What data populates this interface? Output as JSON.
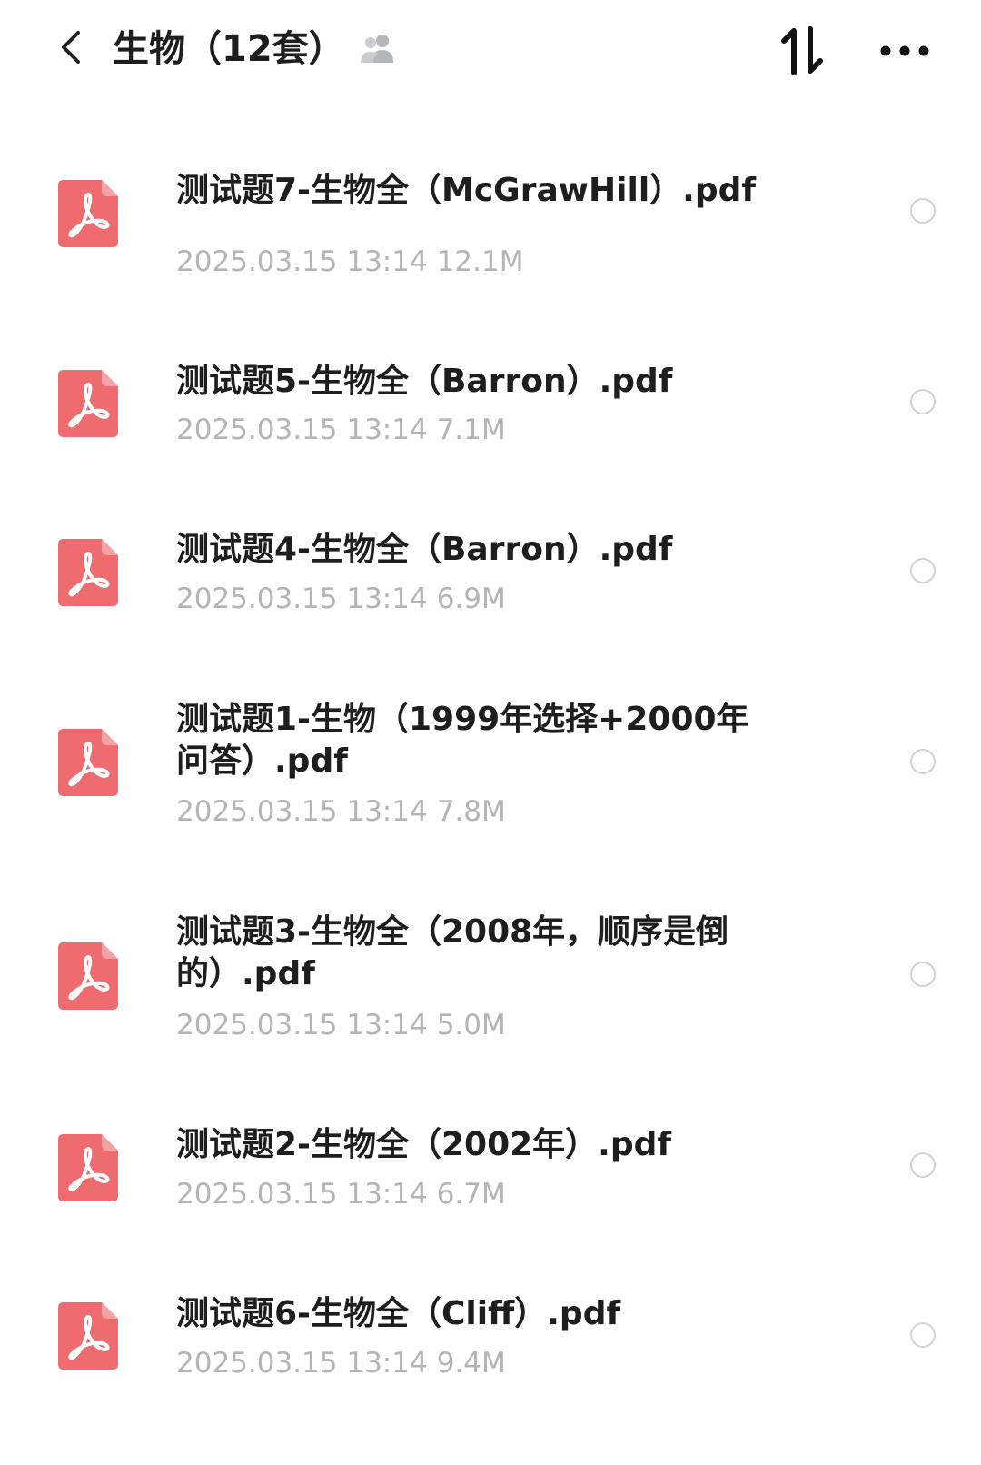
{
  "header": {
    "title": "生物（12套）",
    "back_icon": "chevron-left-icon",
    "group_icon": "people-icon",
    "sort_icon": "sort-arrows-icon",
    "more_icon": "more-horizontal-icon"
  },
  "colors": {
    "pdf_icon": "#ee6b6f",
    "meta_text": "#b4b4b4",
    "title_text": "#1e1e1e",
    "select_circle": "#d2d2d2"
  },
  "files": [
    {
      "name_lines": [
        "测试题7-生物全（McGrawHill）.pdf"
      ],
      "date": "2025.03.15 13:14",
      "size": "12.1M"
    },
    {
      "name_lines": [
        "测试题5-生物全（Barron）.pdf"
      ],
      "date": "2025.03.15 13:14",
      "size": "7.1M"
    },
    {
      "name_lines": [
        "测试题4-生物全（Barron）.pdf"
      ],
      "date": "2025.03.15 13:14",
      "size": "6.9M"
    },
    {
      "name_lines": [
        "测试题1-生物（1999年选择+2000年",
        "问答）.pdf"
      ],
      "date": "2025.03.15 13:14",
      "size": "7.8M"
    },
    {
      "name_lines": [
        "测试题3-生物全（2008年，顺序是倒",
        "的）.pdf"
      ],
      "date": "2025.03.15 13:14",
      "size": "5.0M"
    },
    {
      "name_lines": [
        "测试题2-生物全（2002年）.pdf"
      ],
      "date": "2025.03.15 13:14",
      "size": "6.7M"
    },
    {
      "name_lines": [
        "测试题6-生物全（Cliff）.pdf"
      ],
      "date": "2025.03.15 13:14",
      "size": "9.4M"
    }
  ]
}
